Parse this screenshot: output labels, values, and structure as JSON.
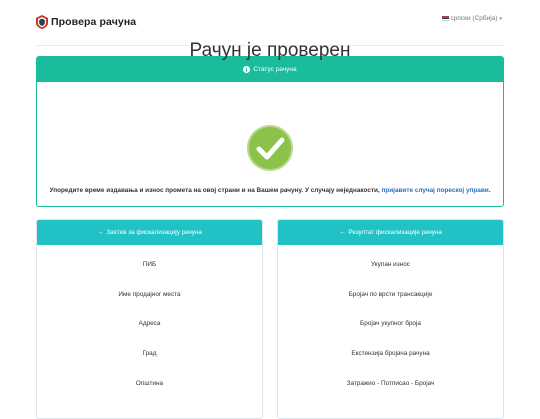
{
  "header": {
    "brand_title": "Провера рачуна",
    "language_label": "српски (Србија)",
    "language_caret": "▾"
  },
  "status_panel": {
    "header_label": "Статус рачуна",
    "title": "Рачун је проверен",
    "note_text": "Упоредите време издавања и износ промета на овој страни и на Вашем рачуну. У случају неједнакости, ",
    "note_link": "пријавите случај пореској управи",
    "note_end": "."
  },
  "request_panel": {
    "header_label": "Захтев за фискализацију рачуна",
    "header_icon": "→",
    "rows": [
      "ПИБ",
      "Име продајног места",
      "Адреса",
      "Град",
      "Општина"
    ]
  },
  "result_panel": {
    "header_label": "Резултат фискализације рачуна",
    "header_icon": "←",
    "rows": [
      "Укупан износ",
      "Бројач по врсти трансакције",
      "Бројач укупног броја",
      "Екстензија бројача рачуна",
      "Затражио - Потписао - Бројач"
    ]
  },
  "colors": {
    "status_green": "#1abc9c",
    "panel_teal": "#21c2c5",
    "check_green": "#8bc34a",
    "link_blue": "#2a6ebb"
  },
  "icons": {
    "brand": "receipt-shield-icon",
    "status": "info-circle-icon",
    "check": "checkmark-circle-icon",
    "flag": "serbian-flag-icon"
  }
}
